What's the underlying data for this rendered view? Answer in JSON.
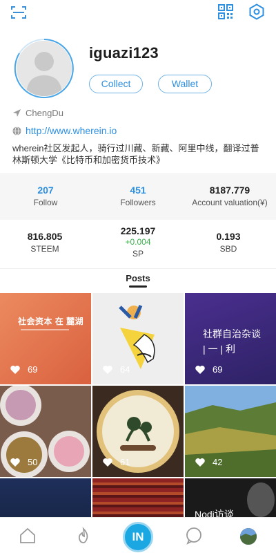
{
  "profile": {
    "username": "iguazi123",
    "collect_label": "Collect",
    "wallet_label": "Wallet",
    "location": "ChengDu",
    "website": "http://www.wherein.io",
    "bio": "wherein社区发起人，骑行过川藏、新藏、阿里中线，翻译过普林斯顿大学《比特币和加密货币技术》"
  },
  "stats": [
    {
      "value": "207",
      "label": "Follow"
    },
    {
      "value": "451",
      "label": "Followers"
    },
    {
      "value": "8187.779",
      "label": "Account valuation(¥)"
    }
  ],
  "wallet": {
    "steem": {
      "value": "816.805",
      "label": "STEEM"
    },
    "sp": {
      "value": "225.197",
      "delta": "+0.004",
      "label": "SP"
    },
    "sbd": {
      "value": "0.193",
      "label": "SBD"
    }
  },
  "tabs": {
    "posts_label": "Posts"
  },
  "posts": [
    {
      "title": "社会资本 在 麓湖",
      "likes": "69",
      "bg": "#e4704f"
    },
    {
      "title": "",
      "likes": "64",
      "bg": "#ececec"
    },
    {
      "title": "社群自治杂谈 | 一 | 利",
      "likes": "69",
      "bg": "#3a2a7c"
    },
    {
      "title": "",
      "likes": "50",
      "bg": "#8b6b5a"
    },
    {
      "title": "",
      "likes": "61",
      "bg": "#5b3a26"
    },
    {
      "title": "",
      "likes": "42",
      "bg": "#6d8a3c"
    },
    {
      "title": "",
      "likes": "",
      "bg": "#16264a"
    },
    {
      "title": "",
      "likes": "",
      "bg": "#7a1f1f"
    },
    {
      "title": "Nodi访谈",
      "likes": "",
      "bg": "#1a1a1a"
    }
  ],
  "nav": {
    "center_label": "IN",
    "icons": [
      "home-icon",
      "fire-icon",
      "in-icon",
      "chat-icon",
      "avatar"
    ]
  },
  "colors": {
    "accent": "#2c8fe0",
    "green": "#38b24a",
    "nav_center": "#1aa7e2"
  }
}
